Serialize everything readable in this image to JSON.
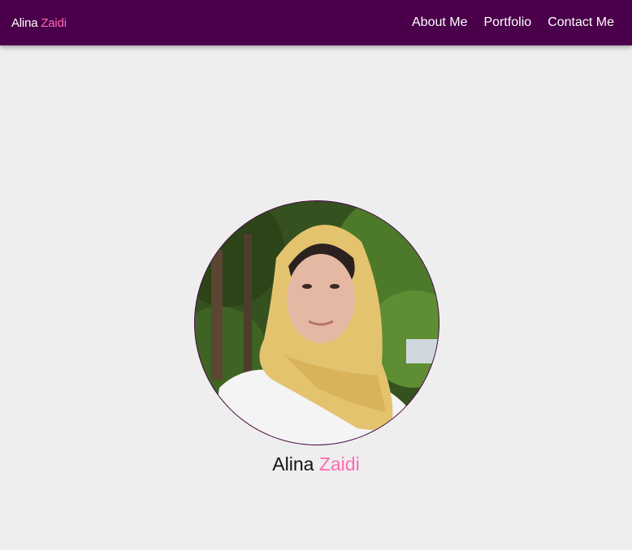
{
  "brand": {
    "first": "Alina",
    "last": "Zaidi"
  },
  "nav": {
    "items": [
      {
        "label": "About Me"
      },
      {
        "label": "Portfolio"
      },
      {
        "label": "Contact Me"
      }
    ]
  },
  "hero": {
    "first_name": "Alina",
    "last_name": "Zaidi"
  },
  "colors": {
    "navbar_bg": "#4a004a",
    "accent": "#ff69b4",
    "page_bg": "#eeeeee",
    "text": "#111111"
  }
}
